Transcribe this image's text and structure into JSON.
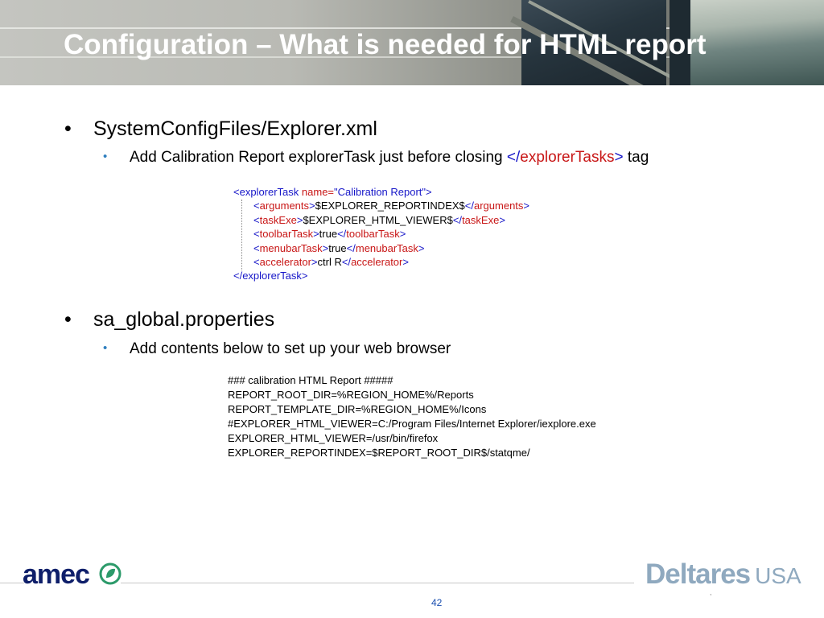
{
  "slide": {
    "title": "Configuration – What is needed for HTML report",
    "page_number": "42"
  },
  "bullets": [
    {
      "text": "SystemConfigFiles/Explorer.xml",
      "sub": {
        "prefix": "Add Calibration Report explorerTask just before closing ",
        "tag_open": "</",
        "tag_name": "explorerTasks",
        "tag_close": ">",
        "suffix": " tag"
      }
    },
    {
      "text": "sa_global.properties",
      "sub": {
        "text": "Add contents below to set up your web browser"
      }
    }
  ],
  "xml_snippet": {
    "lines": [
      {
        "open": "<explorerTask ",
        "attr": "name=",
        "value": "\"Calibration Report\"",
        "close": ">"
      },
      {
        "open_tag": "arguments",
        "content": "$EXPLORER_REPORTINDEX$"
      },
      {
        "open_tag": "taskExe",
        "content": "$EXPLORER_HTML_VIEWER$"
      },
      {
        "open_tag": "toolbarTask",
        "content": "true"
      },
      {
        "open_tag": "menubarTask",
        "content": "true"
      },
      {
        "open_tag": "accelerator",
        "content": "ctrl R"
      },
      {
        "closing": "</explorerTask>"
      }
    ]
  },
  "properties_snippet": {
    "lines": [
      "### calibration HTML Report #####",
      "REPORT_ROOT_DIR=%REGION_HOME%/Reports",
      "REPORT_TEMPLATE_DIR=%REGION_HOME%/Icons",
      "#EXPLORER_HTML_VIEWER=C:/Program Files/Internet Explorer/iexplore.exe",
      "EXPLORER_HTML_VIEWER=/usr/bin/firefox",
      "EXPLORER_REPORTINDEX=$REPORT_ROOT_DIR$/statqme/"
    ]
  },
  "footer": {
    "left_logo": "amec",
    "right_logo_main": "Deltares",
    "right_logo_suffix": "USA"
  },
  "colors": {
    "xml_tag": "#1616c8",
    "xml_name": "#c81616",
    "title_text": "#ffffff",
    "deltares": "#8fa9bf",
    "amec": "#0f1f6a",
    "page_number": "#1a4fb0"
  }
}
